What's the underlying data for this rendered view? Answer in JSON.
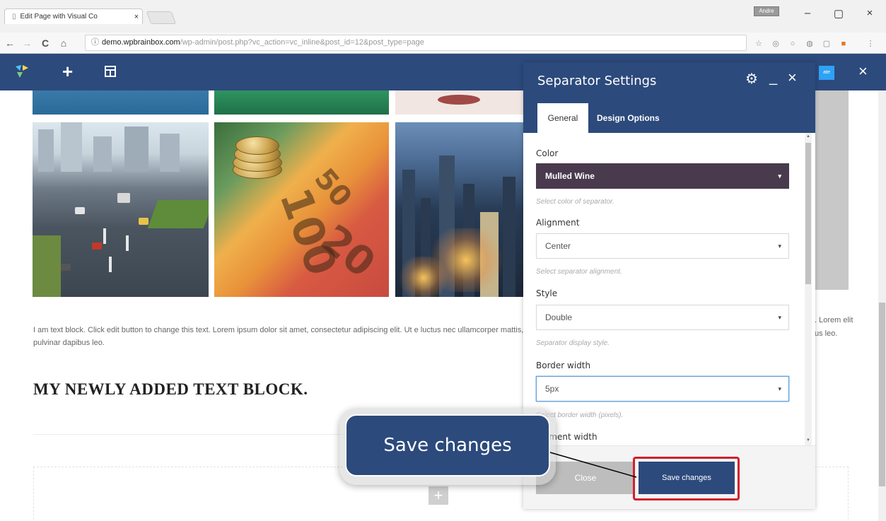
{
  "browser": {
    "tab_title": "Edit Page with Visual Co",
    "tab_close": "×",
    "profile": "Andre",
    "window_minimize": "–",
    "window_maximize": "▢",
    "window_close": "×",
    "back": "←",
    "forward": "→",
    "reload": "C",
    "home": "⌂",
    "url_host": "demo.wpbrainbox.com",
    "url_path": "/wp-admin/post.php?vc_action=vc_inline&post_id=12&post_type=page"
  },
  "vc_toolbar": {
    "add_icon": "+",
    "update_badge": "ate",
    "close_icon": "×"
  },
  "page": {
    "paragraph": "I am text block. Click edit button to change this text. Lorem ipsum dolor sit amet, consectetur adipiscing elit. Ut e luctus nec ullamcorper mattis, pulvinar dapibus leo.",
    "paragraph_right": ". Lorem elit us leo.",
    "heading": "MY NEWLY ADDED TEXT BLOCK.",
    "add_element": "+"
  },
  "panel": {
    "title": "Separator Settings",
    "gear": "⚙",
    "minimize": "_",
    "close": "×",
    "tabs": [
      {
        "label": "General"
      },
      {
        "label": "Design Options"
      }
    ],
    "fields": {
      "color": {
        "label": "Color",
        "value": "Mulled Wine",
        "help": "Select color of separator."
      },
      "alignment": {
        "label": "Alignment",
        "value": "Center",
        "help": "Select separator alignment."
      },
      "style": {
        "label": "Style",
        "value": "Double",
        "help": "Separator display style."
      },
      "border_width": {
        "label": "Border width",
        "value": "5px",
        "help": "Select border width (pixels)."
      },
      "element_width": {
        "label": "Element width"
      }
    },
    "caret": "▾",
    "close_button": "Close",
    "save_button": "Save changes"
  },
  "callout": {
    "text": "Save changes"
  },
  "colors": {
    "brand": "#2c4a7c",
    "highlight": "#d21f2b",
    "mulled_wine": "#4a3a4e"
  }
}
